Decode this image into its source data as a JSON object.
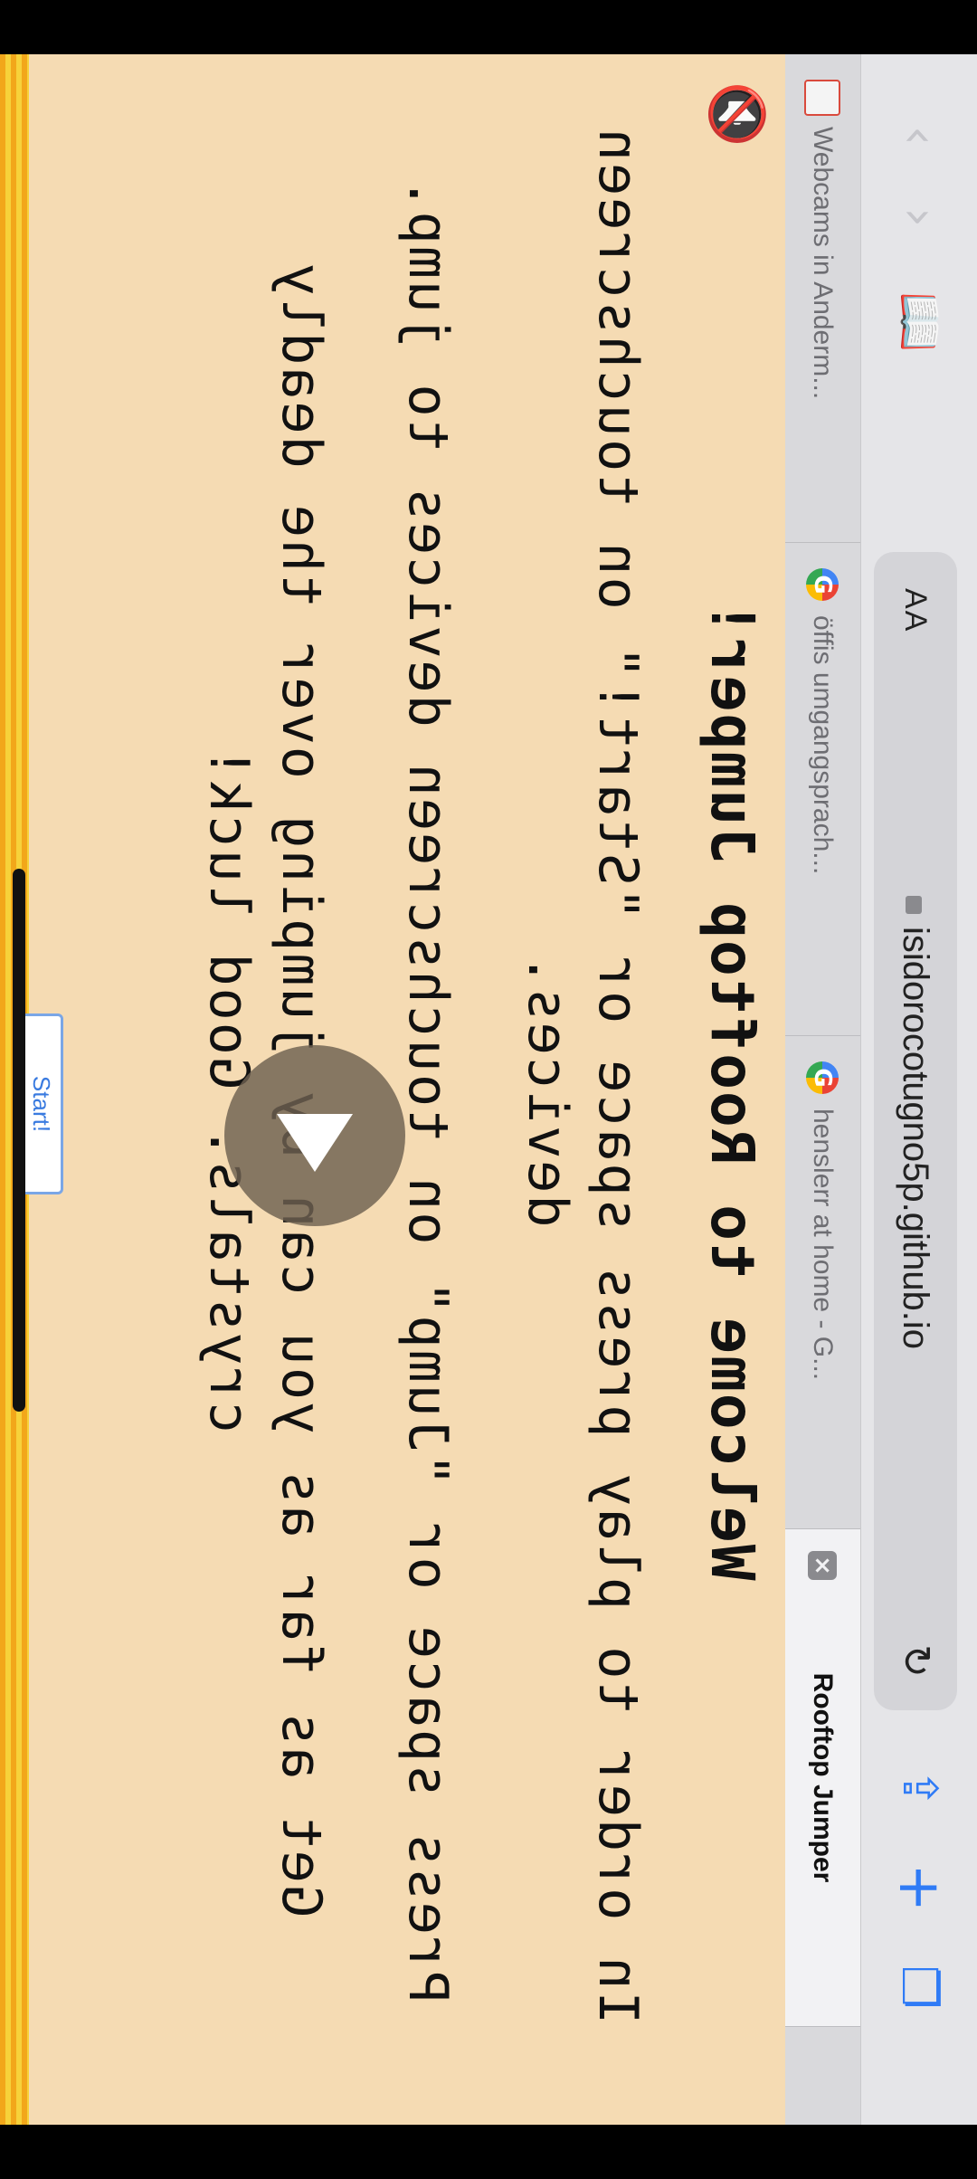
{
  "browser": {
    "aa_label": "AA",
    "url": "isidorocotugno5p.github.io",
    "back_icon": "chevron-left",
    "forward_icon": "chevron-right",
    "bookmarks_icon": "book",
    "share_icon": "share",
    "new_tab_icon": "plus",
    "tabs_icon": "tabs",
    "reload_icon": "reload",
    "accent_color": "#2f7bf6"
  },
  "tabs": [
    {
      "label": "Webcams in Anderm...",
      "favicon": "webcam"
    },
    {
      "label": "öffis umgangsprach...",
      "favicon": "google"
    },
    {
      "label": "henslerr at home - G...",
      "favicon": "google"
    },
    {
      "label": "Rooftop Jumper",
      "active": true
    }
  ],
  "game": {
    "title": "Welcome to Rooftop Jumper!",
    "instruction_1a": "In order to play press space or \"Start!\" on touchscreen",
    "instruction_1b": "devices.",
    "instruction_2": "Press space or \"Jump\" on touchscreen devices to jump.",
    "instruction_3a": "Get as far as you can by jumping over the deadly",
    "instruction_3b": "crystals. Good luck!",
    "start_button": "Start!",
    "background_color": "#f5dbb3"
  }
}
